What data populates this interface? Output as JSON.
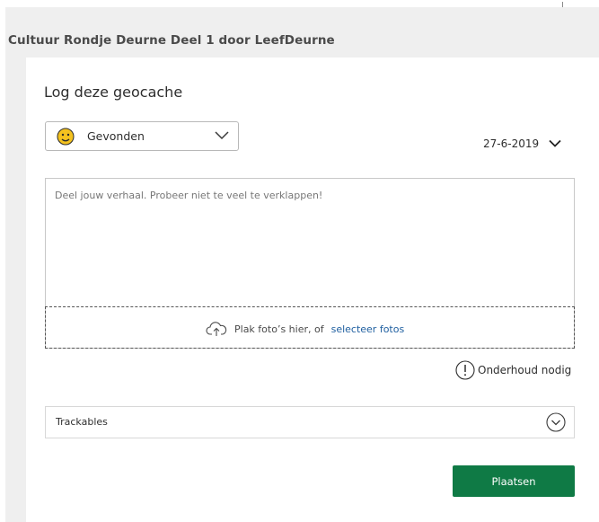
{
  "header": {
    "cache_title": "Cultuur Rondje Deurne Deel 1 door LeefDeurne"
  },
  "log": {
    "title": "Log deze geocache",
    "log_type": {
      "selected": "Gevonden",
      "icon": "smiley-face-icon"
    },
    "date": "27-6-2019",
    "story_placeholder": "Deel jouw verhaal. Probeer niet te veel te verklappen!",
    "photo_drop": {
      "text": "Plak foto’s hier, of",
      "link": "selecteer fotos"
    },
    "maintenance_label": "Onderhoud nodig",
    "trackables_label": "Trackables",
    "submit_label": "Plaatsen"
  },
  "colors": {
    "primary": "#0f7a45",
    "link": "#1f5fa0",
    "smiley": "#f4c21f"
  }
}
